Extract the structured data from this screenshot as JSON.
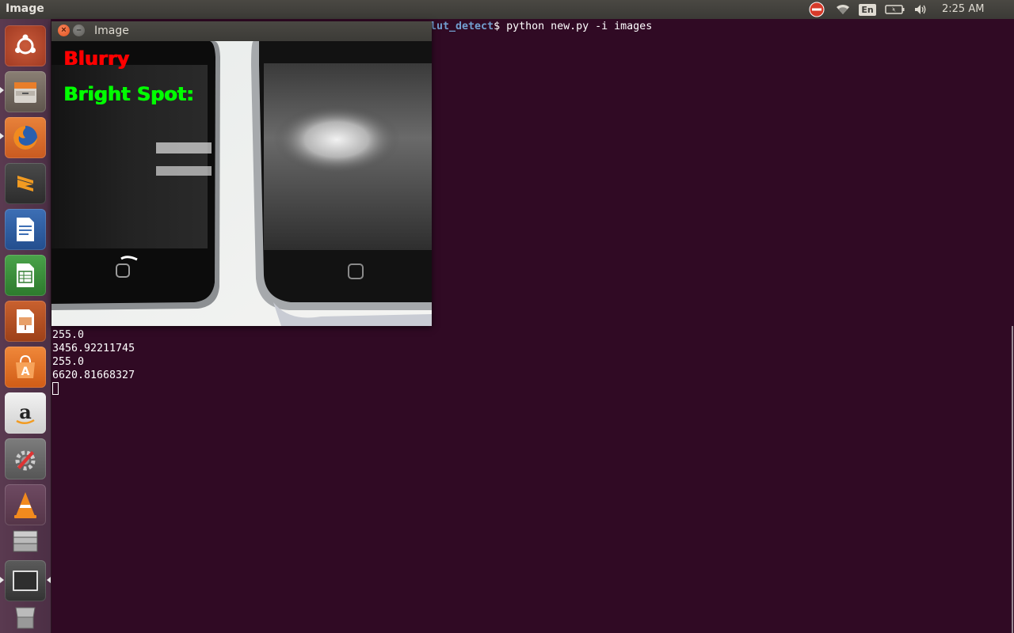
{
  "top_panel": {
    "app_title": "Image",
    "language": "En",
    "clock": "2:25 AM"
  },
  "launcher": {
    "items": [
      {
        "icon": "ubuntu-dash-icon"
      },
      {
        "icon": "files-icon"
      },
      {
        "icon": "firefox-icon"
      },
      {
        "icon": "sublime-text-icon"
      },
      {
        "icon": "libreoffice-writer-icon"
      },
      {
        "icon": "libreoffice-calc-icon"
      },
      {
        "icon": "libreoffice-impress-icon"
      },
      {
        "icon": "software-center-icon"
      },
      {
        "icon": "amazon-icon"
      },
      {
        "icon": "system-settings-icon"
      },
      {
        "icon": "vlc-icon"
      },
      {
        "icon": "workspace-stack-icon"
      },
      {
        "icon": "terminal-icon"
      },
      {
        "icon": "trash-icon"
      }
    ]
  },
  "terminal": {
    "prompt_path": "lut_detect",
    "prompt_suffix": "$ python new.py -i images",
    "output_lines": [
      "255.0",
      "3456.92211745",
      "255.0",
      "6620.81668327"
    ]
  },
  "image_window": {
    "title": "Image",
    "overlay_blurry": "Blurry",
    "overlay_bright_spot": "Bright Spot:"
  },
  "colors": {
    "terminal_bg": "#300a24",
    "blurry_text": "#ff0000",
    "bright_spot_text": "#00ff00"
  }
}
